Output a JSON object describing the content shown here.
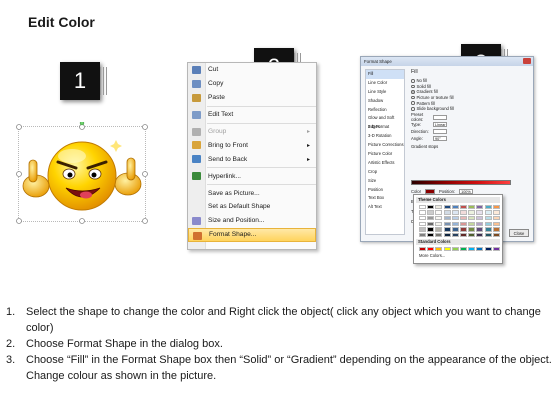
{
  "page": {
    "title": "Edit Color"
  },
  "steps": [
    "1",
    "2",
    "3"
  ],
  "context_menu": {
    "items": [
      {
        "label": "Cut",
        "icon": "scissors-icon",
        "underline": "t",
        "disabled": false
      },
      {
        "label": "Copy",
        "icon": "copy-icon",
        "disabled": false
      },
      {
        "label": "Paste",
        "icon": "paste-icon",
        "disabled": false
      },
      {
        "label": "Edit Text",
        "icon": "edit-text-icon",
        "disabled": false,
        "sep_before": true
      },
      {
        "label": "Group",
        "icon": "group-icon",
        "disabled": true,
        "arrow": true,
        "sep_before": true
      },
      {
        "label": "Bring to Front",
        "icon": "bring-front-icon",
        "disabled": false,
        "arrow": true
      },
      {
        "label": "Send to Back",
        "icon": "send-back-icon",
        "disabled": false,
        "arrow": true
      },
      {
        "label": "Hyperlink...",
        "icon": "hyperlink-icon",
        "disabled": false,
        "sep_before": true
      },
      {
        "label": "Save as Picture...",
        "icon": "",
        "disabled": false,
        "sep_before": true
      },
      {
        "label": "Set as Default Shape",
        "icon": "",
        "disabled": false
      },
      {
        "label": "Size and Position...",
        "icon": "size-position-icon",
        "disabled": false
      },
      {
        "label": "Format Shape...",
        "icon": "format-shape-icon",
        "disabled": false,
        "highlight": true
      }
    ]
  },
  "dialog": {
    "title": "Format Shape",
    "nav": [
      "Fill",
      "Line Color",
      "Line Style",
      "Shadow",
      "Reflection",
      "Glow and Soft Edges",
      "3-D Format",
      "3-D Rotation",
      "Picture Corrections",
      "Picture Color",
      "Artistic Effects",
      "Crop",
      "Size",
      "Position",
      "Text Box",
      "Alt Text"
    ],
    "fill_header": "Fill",
    "fill_options": [
      {
        "label": "No fill",
        "selected": false
      },
      {
        "label": "Solid fill",
        "selected": false
      },
      {
        "label": "Gradient fill",
        "selected": true
      },
      {
        "label": "Picture or texture fill",
        "selected": false
      },
      {
        "label": "Pattern fill",
        "selected": false
      },
      {
        "label": "Slide background fill",
        "selected": false
      }
    ],
    "fields": [
      {
        "label": "Preset colors:",
        "value": ""
      },
      {
        "label": "Type:",
        "value": "Linear"
      },
      {
        "label": "Direction:",
        "value": ""
      },
      {
        "label": "Angle:",
        "value": "90°"
      }
    ],
    "gradient_stops_label": "Gradient stops",
    "color_label": "Color",
    "position_label": "Position:",
    "position_value": "100%",
    "brightness_label": "Brightness:",
    "transparency_label": "Transparency:",
    "rotate_label": "Rotate with shape",
    "close_label": "Close"
  },
  "palette": {
    "theme_label": "Theme Colors",
    "standard_label": "Standard Colors",
    "more_label": "More Colors...",
    "theme_colors": [
      "#ffffff",
      "#000000",
      "#eeece1",
      "#1f497d",
      "#4f81bd",
      "#c0504d",
      "#9bbb59",
      "#8064a2",
      "#4bacc6",
      "#f79646"
    ],
    "standard_colors": [
      "#c00000",
      "#ff0000",
      "#ffc000",
      "#ffff00",
      "#92d050",
      "#00b050",
      "#00b0f0",
      "#0070c0",
      "#002060",
      "#7030a0"
    ]
  },
  "instructions": [
    {
      "num": "1.",
      "text": "Select the shape to change the color and Right click the object( click any object which you want to change color)"
    },
    {
      "num": "2.",
      "text": "Choose Format Shape in the dialog box."
    },
    {
      "num": "3.",
      "text": "Choose “Fill” in the Format Shape box then “Solid” or “Gradient” depending on the appearance of the object. Change colour as shown in the picture."
    }
  ]
}
